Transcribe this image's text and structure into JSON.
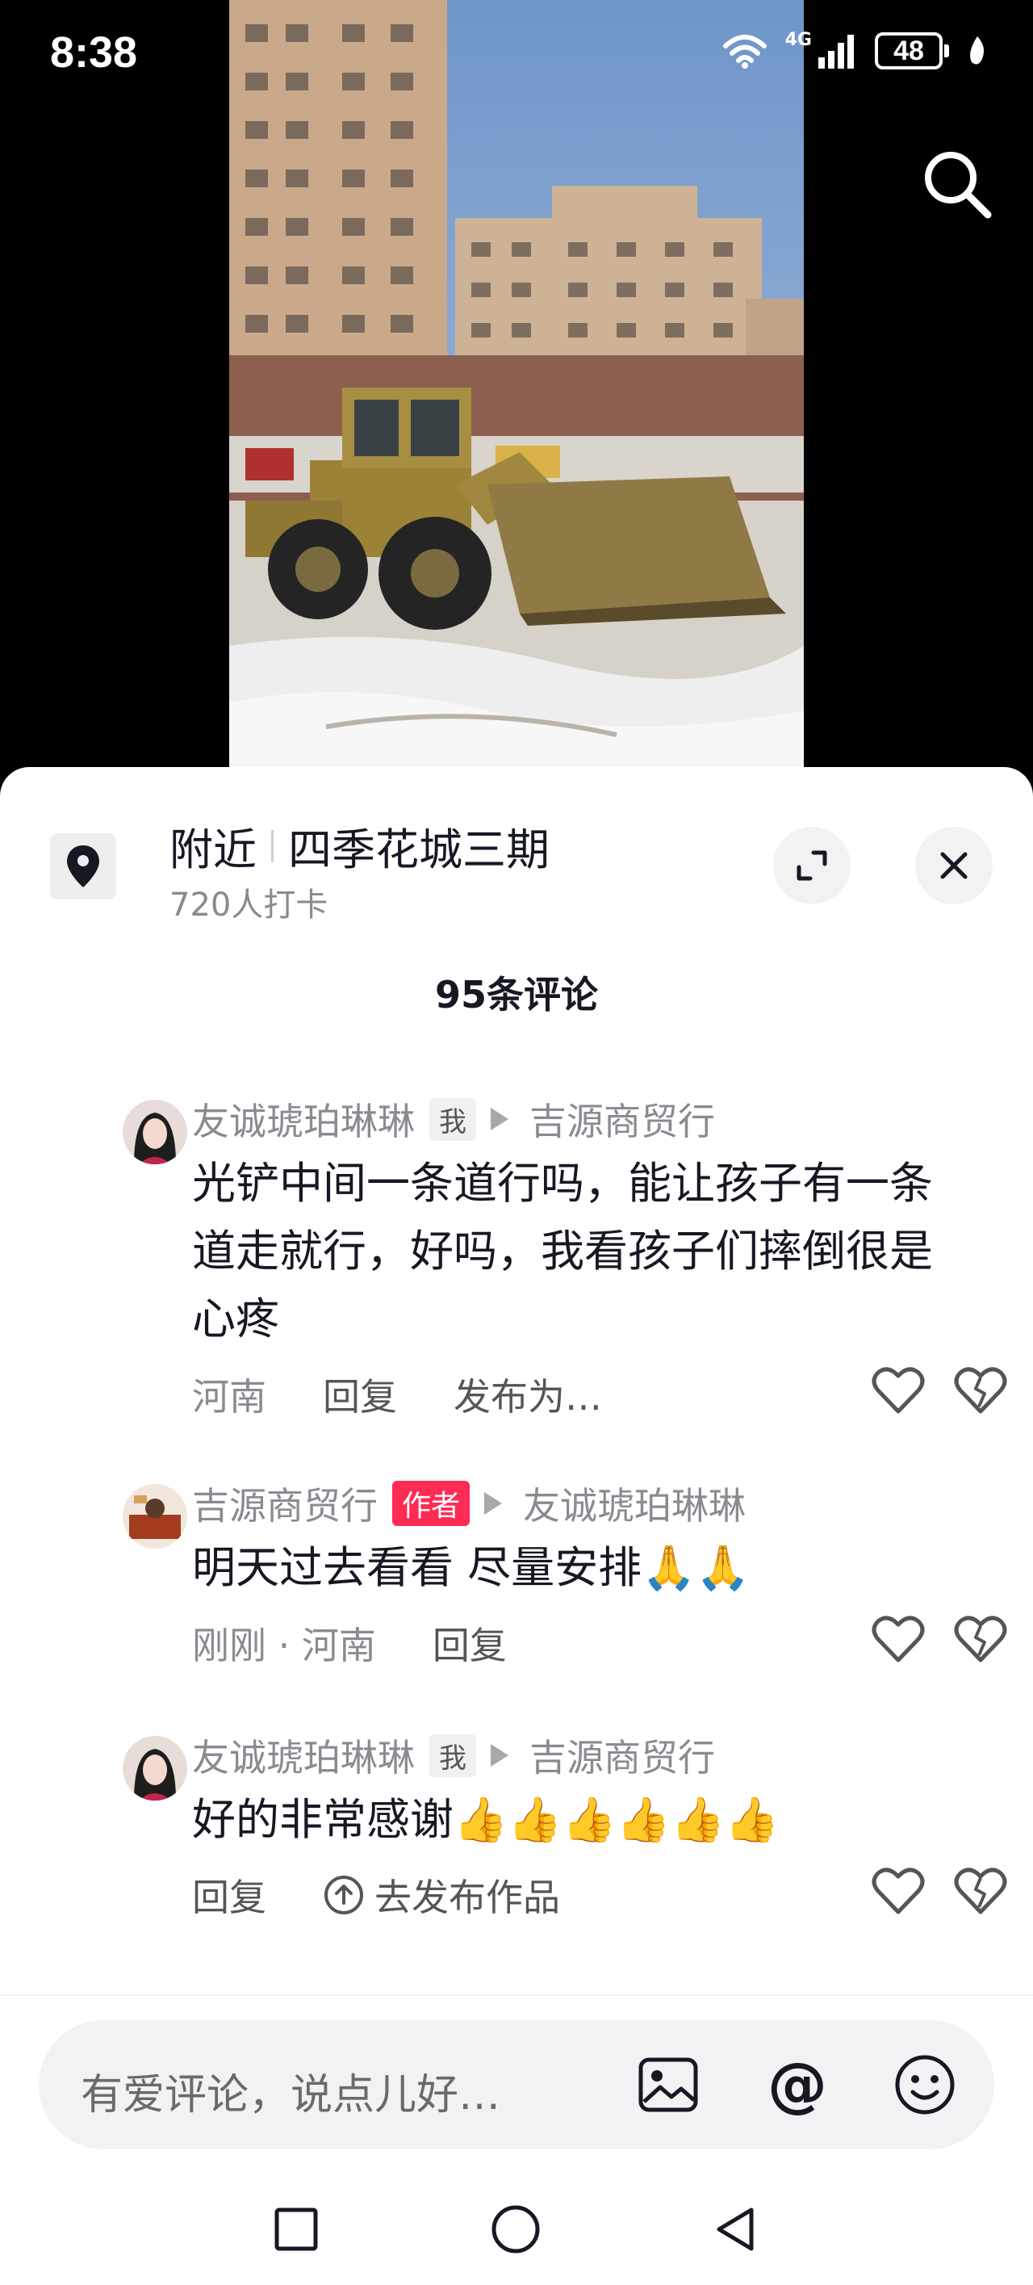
{
  "status_bar": {
    "time": "8:38",
    "network": "4G",
    "battery": "48",
    "icons": [
      "wifi-icon",
      "signal-icon",
      "battery-icon",
      "leaf-icon"
    ]
  },
  "top": {
    "search_icon": "search-icon"
  },
  "location": {
    "category": "附近",
    "place": "四季花城三期",
    "checkins": "720人打卡",
    "icons": [
      "location-pin-icon",
      "expand-icon",
      "close-icon"
    ]
  },
  "comments_header": {
    "count_label": "95条评论"
  },
  "comments": [
    {
      "author": "友诚琥珀琳琳",
      "tag": "我",
      "reply_to": "吉源商贸行",
      "text": "光铲中间一条道行吗，能让孩子有一条道走就行，好吗，我看孩子们摔倒很是心疼",
      "location": "河南",
      "reply_label": "回复",
      "extra": "发布为…"
    },
    {
      "author": "吉源商贸行",
      "tag": "作者",
      "reply_to": "友诚琥珀琳琳",
      "text": "明天过去看看 尽量安排🙏🙏",
      "time_location": "刚刚 · 河南",
      "reply_label": "回复"
    },
    {
      "author": "友诚琥珀琳琳",
      "tag": "我",
      "reply_to": "吉源商贸行",
      "text": "好的非常感谢👍👍👍👍👍👍",
      "reply_label": "回复",
      "extra": "去发布作品"
    }
  ],
  "input": {
    "placeholder": "有爱评论，说点儿好…",
    "icons": [
      "image-icon",
      "at-icon",
      "emoji-icon"
    ],
    "at_symbol": "@"
  },
  "nav": {
    "icons": [
      "recent-apps-icon",
      "home-icon",
      "back-icon"
    ]
  },
  "colors": {
    "accent": "#fe2c55",
    "text_primary": "#161823",
    "text_secondary": "#8a8b91"
  }
}
